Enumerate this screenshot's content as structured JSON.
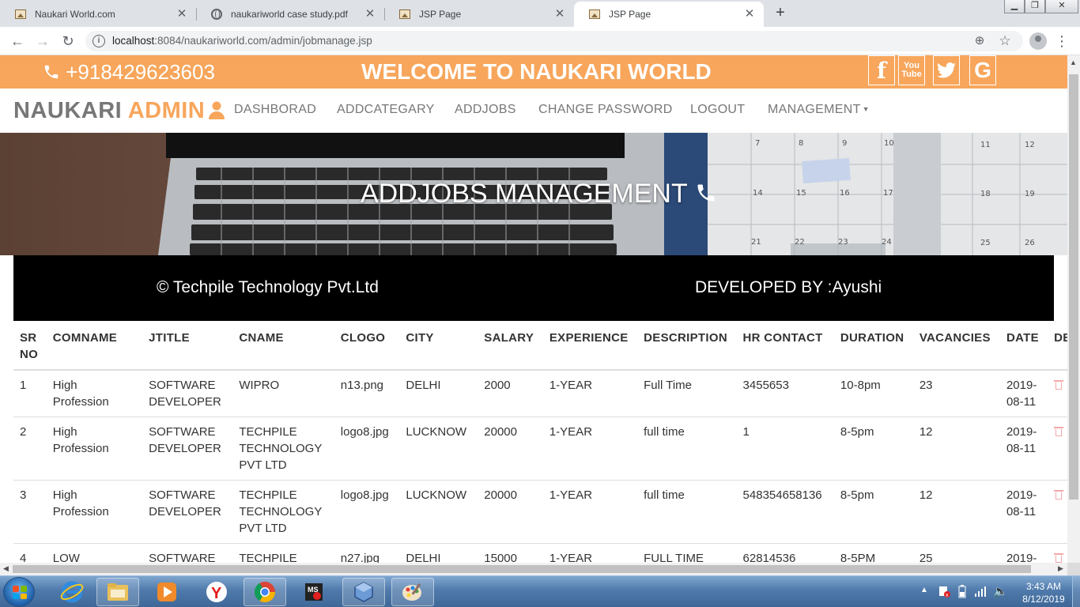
{
  "browser": {
    "tabs": [
      {
        "title": "Naukari World.com",
        "icon": "image-icon",
        "active": false
      },
      {
        "title": "naukariworld case study.pdf",
        "icon": "globe-icon",
        "active": false
      },
      {
        "title": "JSP Page",
        "icon": "image-icon",
        "active": false
      },
      {
        "title": "JSP Page",
        "icon": "image-icon",
        "active": true
      }
    ],
    "url_host": "localhost",
    "url_rest": ":8084/naukariworld.com/admin/jobmanage.jsp"
  },
  "site": {
    "phone": "+918429623603",
    "welcome": "WELCOME TO NAUKARI WORLD",
    "social": [
      "facebook-icon",
      "youtube-icon",
      "twitter-icon",
      "google-icon"
    ],
    "brand_main": "NAUKARI",
    "brand_accent": "ADMIN",
    "nav": [
      "DASHBORAD",
      "ADDCATEGARY",
      "ADDJOBS",
      "CHANGE PASSWORD",
      "LOGOUT",
      "MANAGEMENT"
    ],
    "hero_title": "ADDJOBS MANAGEMENT",
    "copyright": "© Techpile Technology Pvt.Ltd",
    "developer": "DEVELOPED BY :Ayushi",
    "colors": {
      "accent": "#f7a65c",
      "strip": "#000000",
      "text": "#333333",
      "nav": "#777777"
    }
  },
  "table": {
    "headers": [
      "SR NO",
      "COMNAME",
      "JTITLE",
      "CNAME",
      "CLOGO",
      "CITY",
      "SALARY",
      "EXPERIENCE",
      "DESCRIPTION",
      "HR CONTACT",
      "DURATION",
      "VACANCIES",
      "DATE",
      "DELETE"
    ],
    "rows": [
      [
        "1",
        "High Profession",
        "SOFTWARE DEVELOPER",
        "WIPRO",
        "n13.png",
        "DELHI",
        "2000",
        "1-YEAR",
        "Full Time",
        "3455653",
        "10-8pm",
        "23",
        "2019-08-11"
      ],
      [
        "2",
        "High Profession",
        "SOFTWARE DEVELOPER",
        "TECHPILE TECHNOLOGY PVT LTD",
        "logo8.jpg",
        "LUCKNOW",
        "20000",
        "1-YEAR",
        "full time",
        "1",
        "8-5pm",
        "12",
        "2019-08-11"
      ],
      [
        "3",
        "High Profession",
        "SOFTWARE DEVELOPER",
        "TECHPILE TECHNOLOGY PVT LTD",
        "logo8.jpg",
        "LUCKNOW",
        "20000",
        "1-YEAR",
        "full time",
        "548354658136",
        "8-5pm",
        "12",
        "2019-08-11"
      ],
      [
        "4",
        "LOW",
        "SOFTWARE",
        "TECHPILE",
        "n27.jpg",
        "DELHI",
        "15000",
        "1-YEAR",
        "FULL TIME",
        "62814536",
        "8-5PM",
        "25",
        "2019-"
      ]
    ]
  },
  "taskbar": {
    "time": "3:43 AM",
    "date": "8/12/2019",
    "apps": [
      "ie-icon",
      "folder-icon",
      "media-player-icon",
      "yandex-icon",
      "chrome-icon",
      "msaccess-icon",
      "virtualbox-icon",
      "paint-icon"
    ]
  }
}
